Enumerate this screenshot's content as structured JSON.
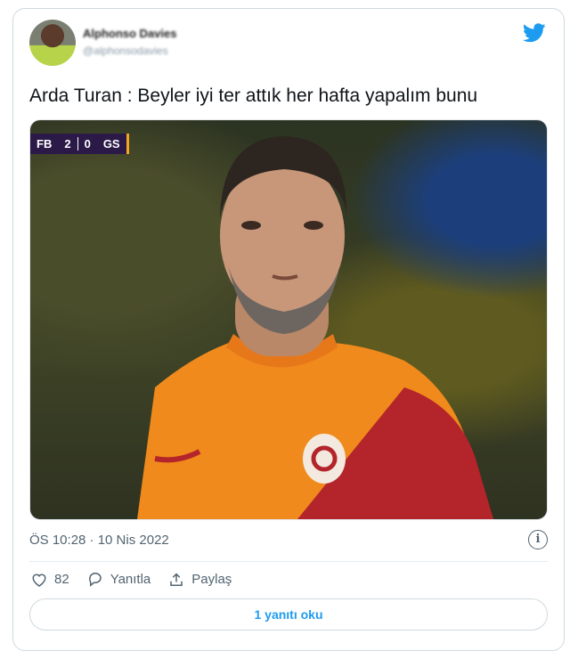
{
  "tweet": {
    "author_name": "Alphonso Davies",
    "author_handle": "@alphonsodavies",
    "text": "Arda Turan : Beyler iyi ter attık her hafta yapalım bunu",
    "timestamp": "ÖS 10:28 · 10 Nis 2022"
  },
  "media": {
    "scoreboard": {
      "home": "FB",
      "home_score": "2",
      "away_score": "0",
      "away": "GS"
    }
  },
  "actions": {
    "like_count": "82",
    "reply_label": "Yanıtla",
    "share_label": "Paylaş"
  },
  "read_replies_label": "1 yanıtı oku",
  "colors": {
    "accent": "#1d9bf0",
    "text": "#0f1419",
    "muted": "#536471"
  },
  "icons": [
    "twitter-bird-icon",
    "info-icon",
    "heart-icon",
    "reply-bubble-icon",
    "share-icon"
  ]
}
